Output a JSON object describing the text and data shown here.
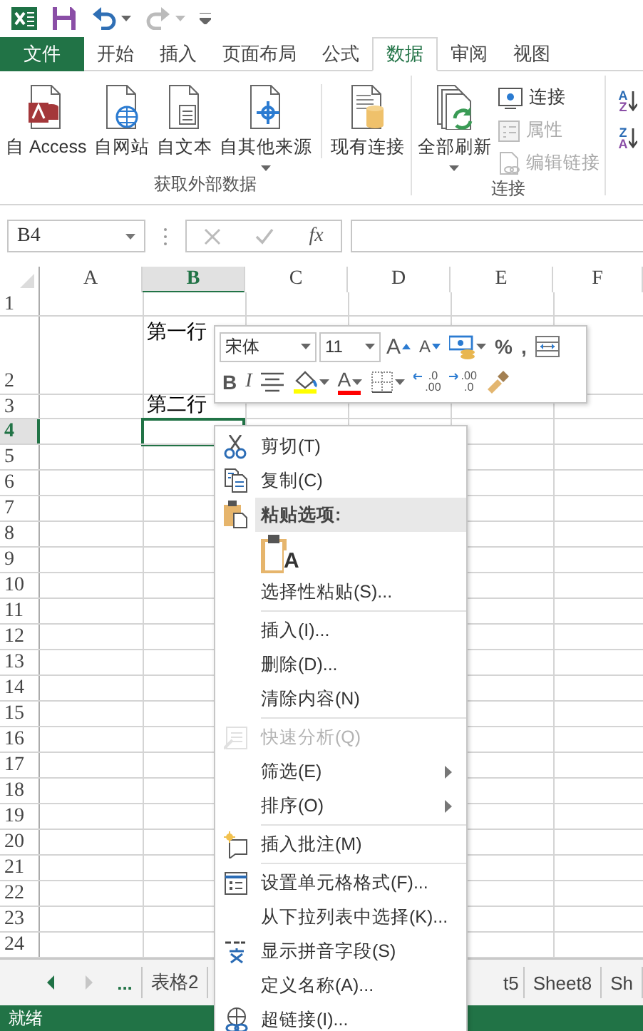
{
  "quick_access": [
    {
      "kind": "logo"
    },
    {
      "kind": "save"
    },
    {
      "kind": "undo",
      "dropdown": true,
      "disabled": false
    },
    {
      "kind": "redo",
      "dropdown": true,
      "disabled": true
    },
    {
      "kind": "customize"
    }
  ],
  "tabs": [
    {
      "label": "文件",
      "kind": "file",
      "selected": false
    },
    {
      "label": "开始",
      "kind": "tab",
      "selected": false
    },
    {
      "label": "插入",
      "kind": "tab",
      "selected": false
    },
    {
      "label": "页面布局",
      "kind": "tab",
      "selected": false
    },
    {
      "label": "公式",
      "kind": "tab",
      "selected": false
    },
    {
      "label": "数据",
      "kind": "tab",
      "selected": true
    },
    {
      "label": "审阅",
      "kind": "tab",
      "selected": false
    },
    {
      "label": "视图",
      "kind": "tab",
      "selected": false
    }
  ],
  "ribbon": {
    "groups": [
      {
        "label": "获取外部数据",
        "controls": [
          {
            "kind": "access",
            "label": "自 Access",
            "dropdown": false,
            "disabled": false
          },
          {
            "kind": "web",
            "label": "自网站",
            "dropdown": false,
            "disabled": false
          },
          {
            "kind": "text",
            "label": "自文本",
            "dropdown": false,
            "disabled": false
          },
          {
            "kind": "other",
            "label": "自其他来源",
            "dropdown": true,
            "disabled": false
          },
          {
            "kind": "existing",
            "label": "现有连接",
            "dropdown": false,
            "disabled": false
          }
        ]
      },
      {
        "label": "连接",
        "controls": [
          {
            "kind": "refresh",
            "label": "全部刷新",
            "dropdown": true,
            "disabled": false
          },
          {
            "kind": "connections",
            "label": "连接",
            "dropdown": false,
            "disabled": false
          },
          {
            "kind": "properties",
            "label": "属性",
            "dropdown": false,
            "disabled": true
          },
          {
            "kind": "edit-links",
            "label": "编辑链接",
            "dropdown": false,
            "disabled": true
          }
        ]
      },
      {
        "controls": [
          {
            "kind": "sort-asc",
            "letters": [
              "A",
              "Z"
            ],
            "dropdown": false,
            "disabled": false
          },
          {
            "kind": "sort-desc",
            "letters": [
              "Z",
              "A"
            ],
            "dropdown": false,
            "disabled": false
          }
        ]
      }
    ]
  },
  "formula_bar": {
    "name_box": "B4",
    "function_label": "fx"
  },
  "sheet": {
    "columns": [
      {
        "label": "A",
        "selected": false
      },
      {
        "label": "B",
        "selected": true
      },
      {
        "label": "C",
        "selected": false
      },
      {
        "label": "D",
        "selected": false
      },
      {
        "label": "E",
        "selected": false
      },
      {
        "label": "F",
        "selected": false
      }
    ],
    "rows": [
      {
        "label": "1",
        "selected": false
      },
      {
        "label": "2",
        "selected": false,
        "column_b": "第一行"
      },
      {
        "label": "3",
        "selected": false,
        "column_b": "第二行"
      },
      {
        "label": "4",
        "selected": true
      },
      {
        "label": "5",
        "selected": false
      },
      {
        "label": "6",
        "selected": false
      },
      {
        "label": "7",
        "selected": false
      },
      {
        "label": "8",
        "selected": false
      },
      {
        "label": "9",
        "selected": false
      },
      {
        "label": "10",
        "selected": false
      },
      {
        "label": "11",
        "selected": false
      },
      {
        "label": "12",
        "selected": false
      },
      {
        "label": "13",
        "selected": false
      },
      {
        "label": "14",
        "selected": false
      },
      {
        "label": "15",
        "selected": false
      },
      {
        "label": "16",
        "selected": false
      },
      {
        "label": "17",
        "selected": false
      },
      {
        "label": "18",
        "selected": false
      },
      {
        "label": "19",
        "selected": false
      },
      {
        "label": "20",
        "selected": false
      },
      {
        "label": "21",
        "selected": false
      },
      {
        "label": "22",
        "selected": false
      },
      {
        "label": "23",
        "selected": false
      },
      {
        "label": "24",
        "selected": false
      }
    ]
  },
  "mini_toolbar": {
    "font": "宋体",
    "size": "11",
    "rows": [
      [
        {
          "kind": "grow",
          "text": "A",
          "dropdown": false
        },
        {
          "kind": "shrink",
          "text": "A",
          "dropdown": false
        },
        {
          "kind": "accounting",
          "dropdown": true
        },
        {
          "kind": "percent",
          "text": "%",
          "dropdown": false
        },
        {
          "kind": "comma",
          "text": ",",
          "dropdown": false
        },
        {
          "kind": "merge",
          "dropdown": false
        }
      ],
      [
        {
          "kind": "bold",
          "text": "B",
          "dropdown": false
        },
        {
          "kind": "italic",
          "text": "I",
          "dropdown": false
        },
        {
          "kind": "center",
          "dropdown": false
        },
        {
          "kind": "fill",
          "dropdown": true,
          "color": "#ffff00"
        },
        {
          "kind": "font-color",
          "text": "A",
          "dropdown": true,
          "color": "#ff0000"
        },
        {
          "kind": "borders",
          "dropdown": true
        },
        {
          "kind": "inc-decimal",
          "lines": [
            ".0",
            ".00"
          ],
          "dropdown": false
        },
        {
          "kind": "dec-decimal",
          "lines": [
            ".00",
            ".0"
          ],
          "dropdown": false
        },
        {
          "kind": "painter",
          "dropdown": false
        }
      ]
    ]
  },
  "context_menu": [
    {
      "kind": "cut",
      "label": "剪切(T)",
      "disabled": false,
      "separator_before": false
    },
    {
      "kind": "copy",
      "label": "复制(C)",
      "disabled": false,
      "separator_before": false
    },
    {
      "kind": "header",
      "label": "粘贴选项:",
      "disabled": false,
      "separator_before": false
    },
    {
      "kind": "paste",
      "label": "A",
      "disabled": false,
      "separator_before": false
    },
    {
      "kind": "plain",
      "label": "选择性粘贴(S)...",
      "disabled": false,
      "separator_before": false
    },
    {
      "kind": "plain",
      "label": "插入(I)...",
      "disabled": false,
      "separator_before": true
    },
    {
      "kind": "plain",
      "label": "删除(D)...",
      "disabled": false,
      "separator_before": false
    },
    {
      "kind": "plain",
      "label": "清除内容(N)",
      "disabled": false,
      "separator_before": false
    },
    {
      "kind": "analysis",
      "label": "快速分析(Q)",
      "disabled": true,
      "separator_before": true
    },
    {
      "kind": "submenu",
      "label": "筛选(E)",
      "disabled": false,
      "separator_before": false
    },
    {
      "kind": "submenu",
      "label": "排序(O)",
      "disabled": false,
      "separator_before": false
    },
    {
      "kind": "comment",
      "label": "插入批注(M)",
      "disabled": false,
      "separator_before": true
    },
    {
      "kind": "format",
      "label": "设置单元格格式(F)...",
      "disabled": false,
      "separator_before": true
    },
    {
      "kind": "plain",
      "label": "从下拉列表中选择(K)...",
      "disabled": false,
      "separator_before": false
    },
    {
      "kind": "phonetic",
      "label": "显示拼音字段(S)",
      "disabled": false,
      "separator_before": false
    },
    {
      "kind": "plain",
      "label": "定义名称(A)...",
      "disabled": false,
      "separator_before": false
    },
    {
      "kind": "link",
      "label": "超链接(I)...",
      "disabled": false,
      "separator_before": false
    }
  ],
  "sheet_tabs": {
    "more": "...",
    "tabs": [
      {
        "label": "表格2",
        "selected": false
      },
      {
        "label": "t5",
        "selected": false
      },
      {
        "label": "Sheet8",
        "selected": false
      },
      {
        "label": "Sh",
        "selected": false
      }
    ]
  },
  "status_bar": {
    "text": "就绪"
  }
}
